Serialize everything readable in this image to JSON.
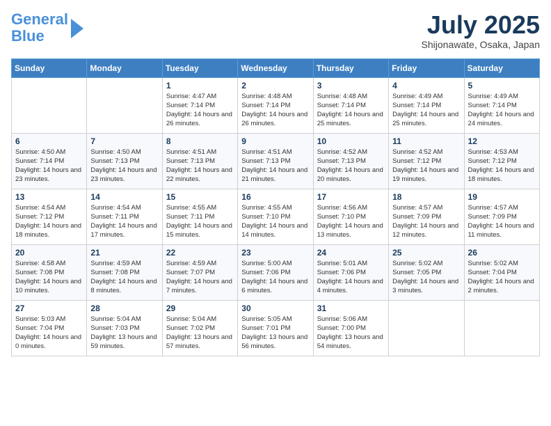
{
  "header": {
    "logo_line1": "General",
    "logo_line2": "Blue",
    "month_year": "July 2025",
    "location": "Shijonawate, Osaka, Japan"
  },
  "weekdays": [
    "Sunday",
    "Monday",
    "Tuesday",
    "Wednesday",
    "Thursday",
    "Friday",
    "Saturday"
  ],
  "weeks": [
    [
      {
        "day": "",
        "sunrise": "",
        "sunset": "",
        "daylight": ""
      },
      {
        "day": "",
        "sunrise": "",
        "sunset": "",
        "daylight": ""
      },
      {
        "day": "1",
        "sunrise": "Sunrise: 4:47 AM",
        "sunset": "Sunset: 7:14 PM",
        "daylight": "Daylight: 14 hours and 26 minutes."
      },
      {
        "day": "2",
        "sunrise": "Sunrise: 4:48 AM",
        "sunset": "Sunset: 7:14 PM",
        "daylight": "Daylight: 14 hours and 26 minutes."
      },
      {
        "day": "3",
        "sunrise": "Sunrise: 4:48 AM",
        "sunset": "Sunset: 7:14 PM",
        "daylight": "Daylight: 14 hours and 25 minutes."
      },
      {
        "day": "4",
        "sunrise": "Sunrise: 4:49 AM",
        "sunset": "Sunset: 7:14 PM",
        "daylight": "Daylight: 14 hours and 25 minutes."
      },
      {
        "day": "5",
        "sunrise": "Sunrise: 4:49 AM",
        "sunset": "Sunset: 7:14 PM",
        "daylight": "Daylight: 14 hours and 24 minutes."
      }
    ],
    [
      {
        "day": "6",
        "sunrise": "Sunrise: 4:50 AM",
        "sunset": "Sunset: 7:14 PM",
        "daylight": "Daylight: 14 hours and 23 minutes."
      },
      {
        "day": "7",
        "sunrise": "Sunrise: 4:50 AM",
        "sunset": "Sunset: 7:13 PM",
        "daylight": "Daylight: 14 hours and 23 minutes."
      },
      {
        "day": "8",
        "sunrise": "Sunrise: 4:51 AM",
        "sunset": "Sunset: 7:13 PM",
        "daylight": "Daylight: 14 hours and 22 minutes."
      },
      {
        "day": "9",
        "sunrise": "Sunrise: 4:51 AM",
        "sunset": "Sunset: 7:13 PM",
        "daylight": "Daylight: 14 hours and 21 minutes."
      },
      {
        "day": "10",
        "sunrise": "Sunrise: 4:52 AM",
        "sunset": "Sunset: 7:13 PM",
        "daylight": "Daylight: 14 hours and 20 minutes."
      },
      {
        "day": "11",
        "sunrise": "Sunrise: 4:52 AM",
        "sunset": "Sunset: 7:12 PM",
        "daylight": "Daylight: 14 hours and 19 minutes."
      },
      {
        "day": "12",
        "sunrise": "Sunrise: 4:53 AM",
        "sunset": "Sunset: 7:12 PM",
        "daylight": "Daylight: 14 hours and 18 minutes."
      }
    ],
    [
      {
        "day": "13",
        "sunrise": "Sunrise: 4:54 AM",
        "sunset": "Sunset: 7:12 PM",
        "daylight": "Daylight: 14 hours and 18 minutes."
      },
      {
        "day": "14",
        "sunrise": "Sunrise: 4:54 AM",
        "sunset": "Sunset: 7:11 PM",
        "daylight": "Daylight: 14 hours and 17 minutes."
      },
      {
        "day": "15",
        "sunrise": "Sunrise: 4:55 AM",
        "sunset": "Sunset: 7:11 PM",
        "daylight": "Daylight: 14 hours and 15 minutes."
      },
      {
        "day": "16",
        "sunrise": "Sunrise: 4:55 AM",
        "sunset": "Sunset: 7:10 PM",
        "daylight": "Daylight: 14 hours and 14 minutes."
      },
      {
        "day": "17",
        "sunrise": "Sunrise: 4:56 AM",
        "sunset": "Sunset: 7:10 PM",
        "daylight": "Daylight: 14 hours and 13 minutes."
      },
      {
        "day": "18",
        "sunrise": "Sunrise: 4:57 AM",
        "sunset": "Sunset: 7:09 PM",
        "daylight": "Daylight: 14 hours and 12 minutes."
      },
      {
        "day": "19",
        "sunrise": "Sunrise: 4:57 AM",
        "sunset": "Sunset: 7:09 PM",
        "daylight": "Daylight: 14 hours and 11 minutes."
      }
    ],
    [
      {
        "day": "20",
        "sunrise": "Sunrise: 4:58 AM",
        "sunset": "Sunset: 7:08 PM",
        "daylight": "Daylight: 14 hours and 10 minutes."
      },
      {
        "day": "21",
        "sunrise": "Sunrise: 4:59 AM",
        "sunset": "Sunset: 7:08 PM",
        "daylight": "Daylight: 14 hours and 8 minutes."
      },
      {
        "day": "22",
        "sunrise": "Sunrise: 4:59 AM",
        "sunset": "Sunset: 7:07 PM",
        "daylight": "Daylight: 14 hours and 7 minutes."
      },
      {
        "day": "23",
        "sunrise": "Sunrise: 5:00 AM",
        "sunset": "Sunset: 7:06 PM",
        "daylight": "Daylight: 14 hours and 6 minutes."
      },
      {
        "day": "24",
        "sunrise": "Sunrise: 5:01 AM",
        "sunset": "Sunset: 7:06 PM",
        "daylight": "Daylight: 14 hours and 4 minutes."
      },
      {
        "day": "25",
        "sunrise": "Sunrise: 5:02 AM",
        "sunset": "Sunset: 7:05 PM",
        "daylight": "Daylight: 14 hours and 3 minutes."
      },
      {
        "day": "26",
        "sunrise": "Sunrise: 5:02 AM",
        "sunset": "Sunset: 7:04 PM",
        "daylight": "Daylight: 14 hours and 2 minutes."
      }
    ],
    [
      {
        "day": "27",
        "sunrise": "Sunrise: 5:03 AM",
        "sunset": "Sunset: 7:04 PM",
        "daylight": "Daylight: 14 hours and 0 minutes."
      },
      {
        "day": "28",
        "sunrise": "Sunrise: 5:04 AM",
        "sunset": "Sunset: 7:03 PM",
        "daylight": "Daylight: 13 hours and 59 minutes."
      },
      {
        "day": "29",
        "sunrise": "Sunrise: 5:04 AM",
        "sunset": "Sunset: 7:02 PM",
        "daylight": "Daylight: 13 hours and 57 minutes."
      },
      {
        "day": "30",
        "sunrise": "Sunrise: 5:05 AM",
        "sunset": "Sunset: 7:01 PM",
        "daylight": "Daylight: 13 hours and 56 minutes."
      },
      {
        "day": "31",
        "sunrise": "Sunrise: 5:06 AM",
        "sunset": "Sunset: 7:00 PM",
        "daylight": "Daylight: 13 hours and 54 minutes."
      },
      {
        "day": "",
        "sunrise": "",
        "sunset": "",
        "daylight": ""
      },
      {
        "day": "",
        "sunrise": "",
        "sunset": "",
        "daylight": ""
      }
    ]
  ]
}
